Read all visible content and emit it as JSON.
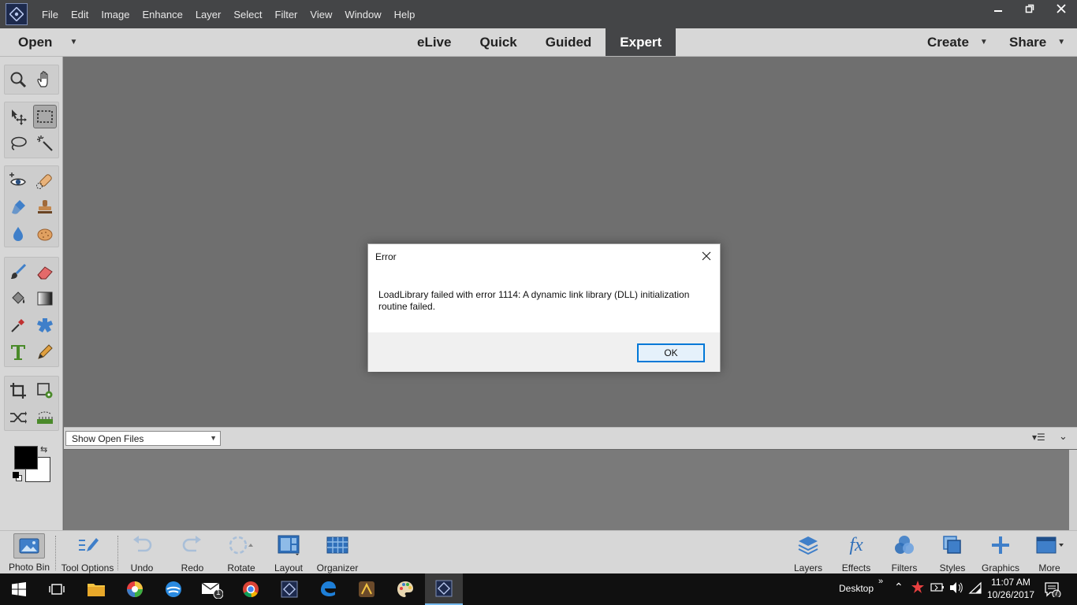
{
  "menubar": {
    "items": [
      "File",
      "Edit",
      "Image",
      "Enhance",
      "Layer",
      "Select",
      "Filter",
      "View",
      "Window",
      "Help"
    ]
  },
  "modebar": {
    "open_label": "Open",
    "tabs": [
      {
        "label": "eLive",
        "active": false
      },
      {
        "label": "Quick",
        "active": false
      },
      {
        "label": "Guided",
        "active": false
      },
      {
        "label": "Expert",
        "active": true
      }
    ],
    "create_label": "Create",
    "share_label": "Share"
  },
  "tools": {
    "icons": [
      "zoom-icon",
      "hand-icon",
      "move-icon",
      "marquee-icon",
      "lasso-icon",
      "magic-wand-icon",
      "red-eye-icon",
      "spot-healing-icon",
      "smart-brush-icon",
      "clone-stamp-icon",
      "blur-icon",
      "sponge-icon",
      "brush-icon",
      "eraser-icon",
      "paint-bucket-icon",
      "gradient-icon",
      "eyedropper-icon",
      "custom-shape-icon",
      "type-icon",
      "pencil-icon",
      "crop-icon",
      "recompose-icon",
      "content-aware-move-icon",
      "straighten-icon"
    ]
  },
  "bin": {
    "select_value": "Show Open Files"
  },
  "bottombar": {
    "left": [
      {
        "label": "Photo Bin",
        "icon": "photo-bin-icon"
      },
      {
        "label": "Tool Options",
        "icon": "tool-options-icon"
      },
      {
        "label": "Undo",
        "icon": "undo-icon"
      },
      {
        "label": "Redo",
        "icon": "redo-icon"
      },
      {
        "label": "Rotate",
        "icon": "rotate-icon"
      },
      {
        "label": "Layout",
        "icon": "layout-icon"
      },
      {
        "label": "Organizer",
        "icon": "organizer-icon"
      }
    ],
    "right": [
      {
        "label": "Layers",
        "icon": "layers-icon"
      },
      {
        "label": "Effects",
        "icon": "effects-icon"
      },
      {
        "label": "Filters",
        "icon": "filters-icon"
      },
      {
        "label": "Styles",
        "icon": "styles-icon"
      },
      {
        "label": "Graphics",
        "icon": "graphics-icon"
      },
      {
        "label": "More",
        "icon": "more-icon"
      }
    ]
  },
  "dialog": {
    "title": "Error",
    "message": "LoadLibrary failed with error 1114: A dynamic link library (DLL) initialization routine failed.",
    "ok_label": "OK"
  },
  "taskbar": {
    "desktop_label": "Desktop",
    "time": "11:07 AM",
    "date": "10/26/2017",
    "mail_badge": "1",
    "notification_count": "7"
  },
  "colors": {
    "menubar_bg": "#444547",
    "panel_bg": "#d7d7d7",
    "canvas_bg": "#6f6f6f",
    "accent": "#0078d7"
  }
}
